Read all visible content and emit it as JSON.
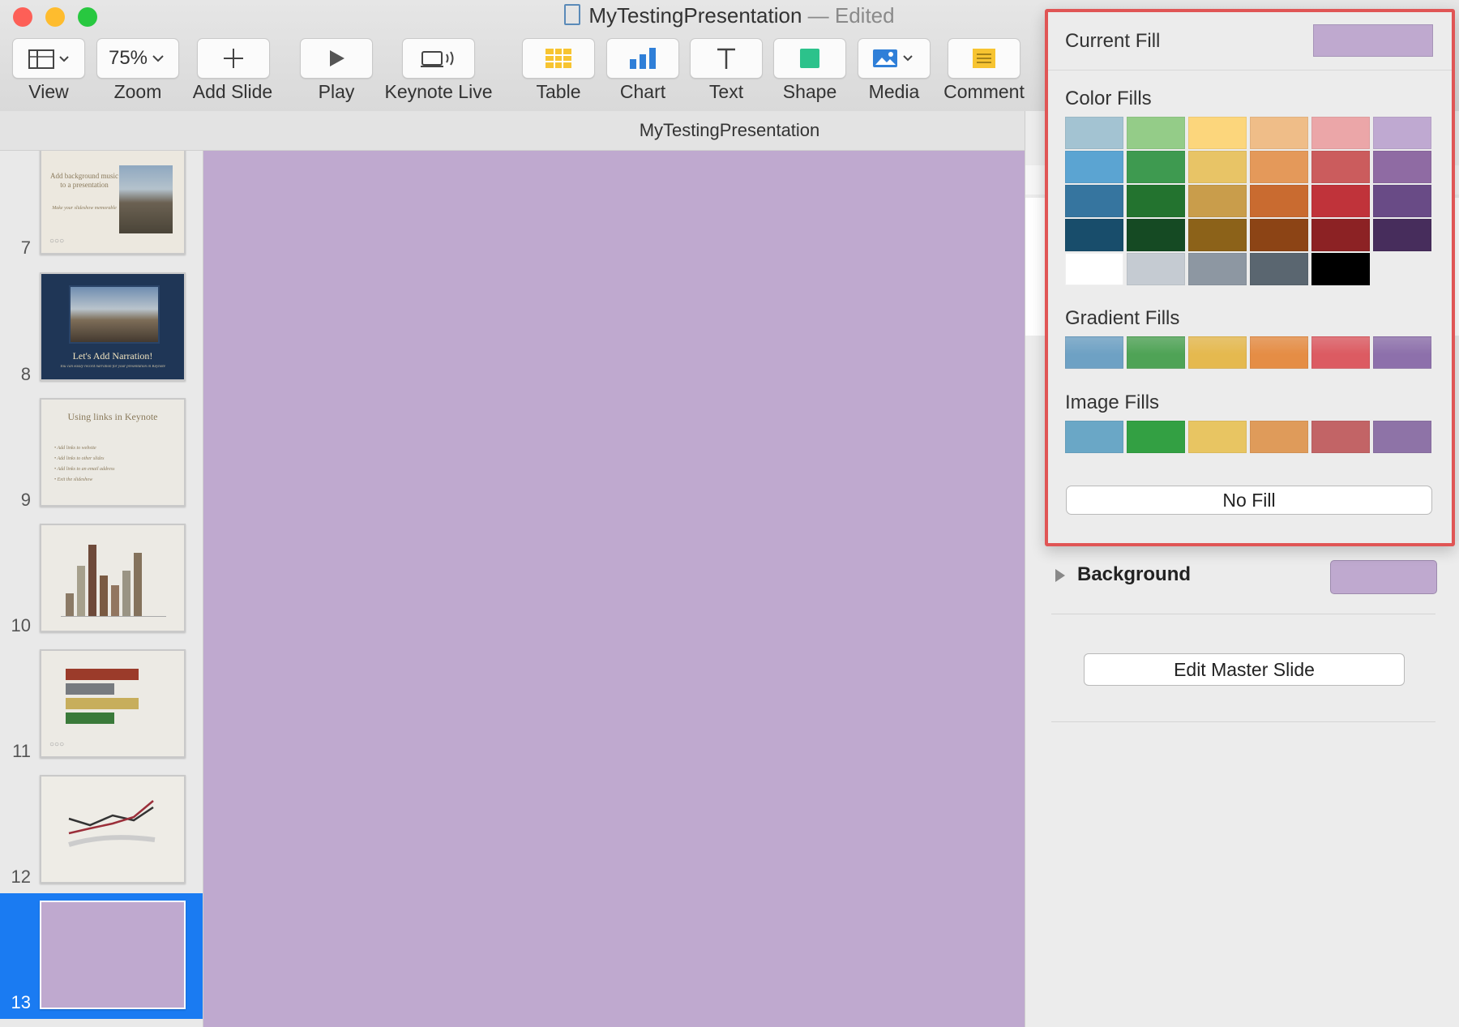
{
  "window": {
    "title": "MyTestingPresentation",
    "title_suffix": "— Edited",
    "document_name": "MyTestingPresentation"
  },
  "toolbar": {
    "view": "View",
    "zoom_value": "75%",
    "zoom": "Zoom",
    "add_slide": "Add Slide",
    "play": "Play",
    "keynote_live": "Keynote Live",
    "table": "Table",
    "chart": "Chart",
    "text": "Text",
    "shape": "Shape",
    "media": "Media",
    "comment": "Comment"
  },
  "slides": {
    "s7": {
      "number": "7",
      "title": "Add background music to a presentation",
      "subtitle": "Make your slideshow memorable"
    },
    "s8": {
      "number": "8",
      "title": "Let's Add Narration!",
      "subtitle": "You can easily record narration for your presentation in Keynote"
    },
    "s9": {
      "number": "9",
      "title": "Using links in Keynote",
      "bullets": [
        "Add links to website",
        "Add links to other slides",
        "Add links to an email address",
        "Exit the slideshow"
      ]
    },
    "s10": {
      "number": "10"
    },
    "s11": {
      "number": "11"
    },
    "s12": {
      "number": "12"
    },
    "s13": {
      "number": "13",
      "selected": true
    }
  },
  "fill_popover": {
    "current_fill": "Current Fill",
    "current_fill_color": "#bfa9cf",
    "color_fills": "Color Fills",
    "gradient_fills": "Gradient Fills",
    "image_fills": "Image Fills",
    "no_fill": "No Fill",
    "color_rows": [
      [
        "#a3c3d2",
        "#94cc88",
        "#fcd67c",
        "#efbd88",
        "#eba6a8",
        "#bfa9d1"
      ],
      [
        "#5ba4d2",
        "#3e9a50",
        "#e8c466",
        "#e4995a",
        "#cb5c5d",
        "#8f6ba3"
      ],
      [
        "#36759f",
        "#23732f",
        "#c99d4b",
        "#c96b30",
        "#c0333a",
        "#694b86"
      ],
      [
        "#184d6b",
        "#154a23",
        "#8c6219",
        "#8c4415",
        "#8c2224",
        "#472d5c"
      ],
      [
        "#ffffff",
        "#c5cbd2",
        "#8d97a2",
        "#5a6670",
        "#000000"
      ]
    ],
    "gradient_colors": [
      "#6ea1c4",
      "#4fa356",
      "#e5b94f",
      "#e58d45",
      "#dc5b62",
      "#8d70ab"
    ],
    "image_colors": [
      "#6aa7c6",
      "#33a043",
      "#e8c562",
      "#df9b5a",
      "#c26466",
      "#8e73a7"
    ]
  },
  "inspector": {
    "background_label": "Background",
    "background_color": "#bfa9cf",
    "edit_master": "Edit Master Slide"
  }
}
